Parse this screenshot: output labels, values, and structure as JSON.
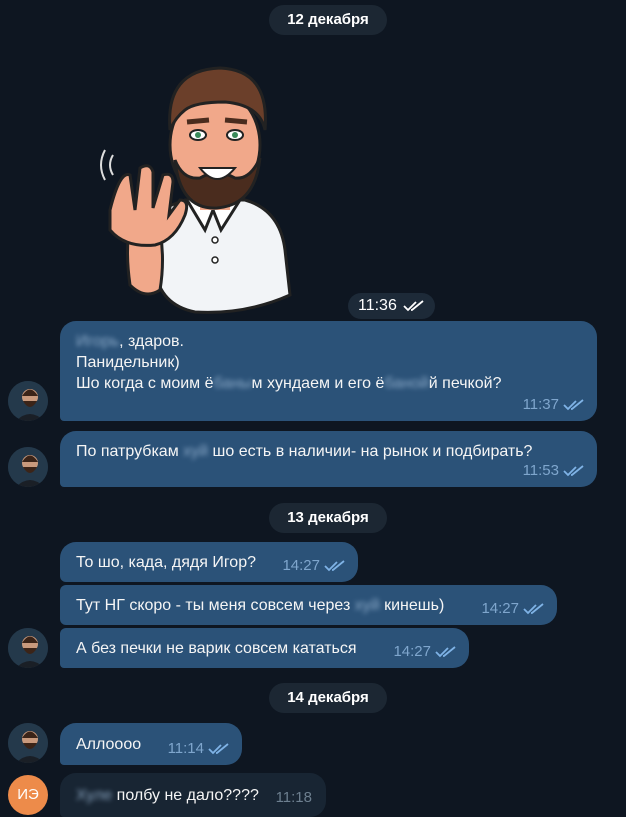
{
  "dates": [
    "12 декабря",
    "13 декабря",
    "14 декабря"
  ],
  "sticker": {
    "time": "11:36",
    "icon": "double-check-icon"
  },
  "messages": {
    "m1": {
      "line1_blur": "Игорь",
      "line1_rest": ", здаров.",
      "line2": "Панидельник)",
      "line3_a": "Шо когда с моим ё",
      "line3_blur1": "баны",
      "line3_b": "м хундаем и его ё",
      "line3_blur2": "баной",
      "line3_c": "й печкой?",
      "time": "11:37"
    },
    "m2": {
      "text_a": "По патрубкам ",
      "text_blur": "хуй",
      "text_b": " шо есть в наличии- на рынок и подбирать?",
      "time": "11:53"
    },
    "m3": {
      "text": "То шо, када, дядя Игор?",
      "time": "14:27"
    },
    "m4": {
      "text_a": "Тут НГ скоро - ты меня совсем через ",
      "text_blur": "хуй",
      "text_b": " кинешь)",
      "time": "14:27"
    },
    "m5": {
      "text": "А без печки не варик совсем кататься",
      "time": "14:27"
    },
    "m6": {
      "text": "Аллоооо",
      "time": "11:14"
    },
    "m7": {
      "text_blur": "Хуле",
      "text_b": " полбу не дало????",
      "time": "11:18"
    }
  },
  "contact": {
    "initials": "ИЭ",
    "avatar_color": "#ed8b4a"
  },
  "colors": {
    "background": "#0e1621",
    "outgoing": "#2b5278",
    "incoming": "#182533",
    "check": "#7fb3e6"
  }
}
